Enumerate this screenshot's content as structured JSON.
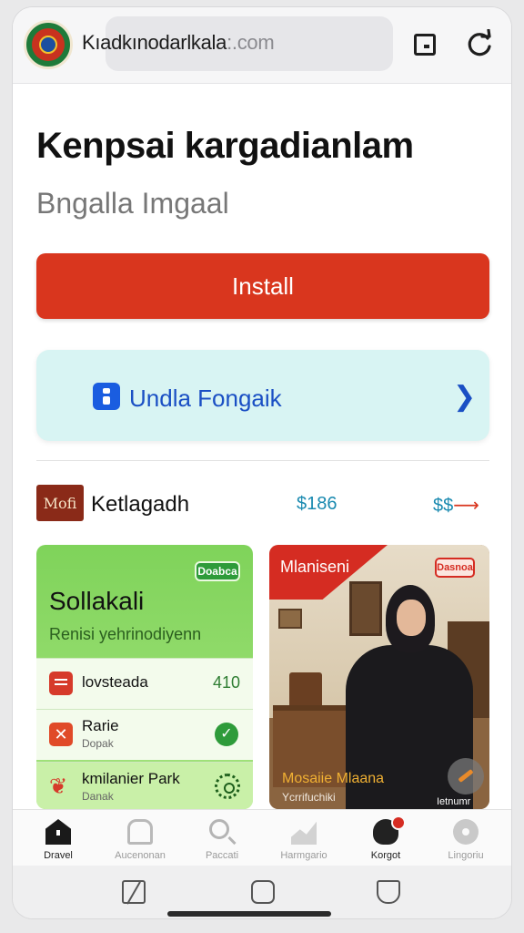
{
  "browser": {
    "url_main": "Kıadkınodarlkala",
    "url_tld": ":.com",
    "icons": {
      "site_logo": "emblem-logo",
      "tabs": "tabs-icon",
      "reload": "reload-icon"
    }
  },
  "header": {
    "title": "Kenpsai  kargadianlam",
    "subtitle": "Bngalla Imgaal"
  },
  "install_button": {
    "label": "Install",
    "color": "#d9361e"
  },
  "info_card": {
    "label": "Undla Fongaik",
    "icon": "app-icon",
    "accent": "#1a4fc4"
  },
  "category": {
    "badge": "Mofi",
    "title": "Ketlagadh",
    "price": "$186",
    "more": "$$",
    "more_arrow": "⟶"
  },
  "green_card": {
    "badge": "Doabca",
    "title": "Sollakali",
    "subtitle": "Renisi yehrinodiyenn",
    "rows": [
      {
        "label": "lovsteada",
        "value": "410",
        "icon": "list-icon"
      },
      {
        "label": "Rarie",
        "sub": "Dopak",
        "icon": "tools-icon",
        "status_icon": "check-icon"
      },
      {
        "label": "kmilanier Park",
        "sub": "Danak",
        "icon": "leaf-icon",
        "status_icon": "gear-icon"
      }
    ]
  },
  "photo_card": {
    "ribbon_title": "Mlaniseni",
    "badge": "Dasnoa",
    "caption": "Mosaiie Mlaana",
    "subcaption": "Ycrrifuchiki",
    "fab_label": "Ietnumr"
  },
  "tabbar": {
    "tabs": [
      {
        "label": "Dravel",
        "icon": "home-icon",
        "active": true
      },
      {
        "label": "Aucenonan",
        "icon": "bus-icon",
        "active": false
      },
      {
        "label": "Paccati",
        "icon": "search-icon",
        "active": false
      },
      {
        "label": "Harmgario",
        "icon": "chart-icon",
        "active": false
      },
      {
        "label": "Korgot",
        "icon": "user-icon",
        "active": true
      },
      {
        "label": "Lingoriu",
        "icon": "settings-icon",
        "active": false
      }
    ]
  },
  "system_nav": {
    "back": "back-icon",
    "home": "home-button-icon",
    "recents": "recents-icon"
  }
}
